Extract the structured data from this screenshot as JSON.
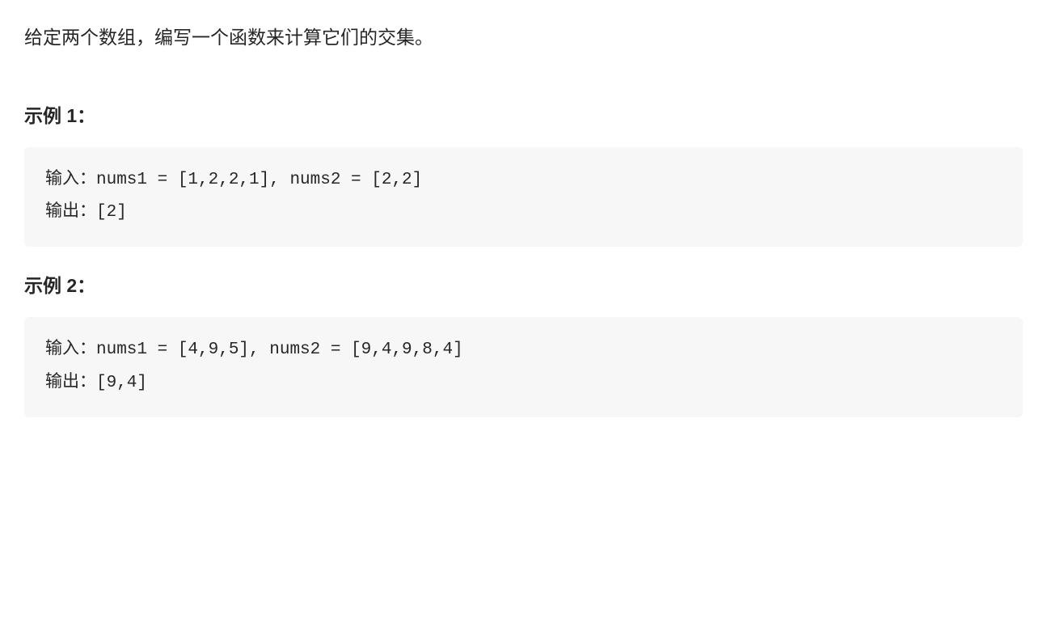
{
  "description": "给定两个数组，编写一个函数来计算它们的交集。",
  "examples": [
    {
      "heading": "示例 1：",
      "input_label": "输入：",
      "input_value": "nums1 = [1,2,2,1], nums2 = [2,2]",
      "output_label": "输出：",
      "output_value": "[2]"
    },
    {
      "heading": "示例 2：",
      "input_label": "输入：",
      "input_value": "nums1 = [4,9,5], nums2 = [9,4,9,8,4]",
      "output_label": "输出：",
      "output_value": "[9,4]"
    }
  ]
}
